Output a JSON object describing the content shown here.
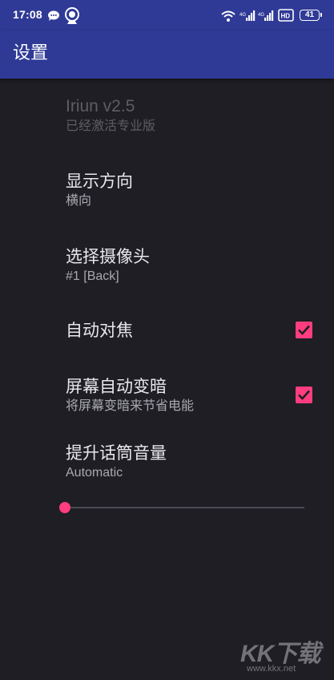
{
  "status_bar": {
    "time": "17:08",
    "battery": "41",
    "icons": [
      "chat-bubble-icon",
      "webcam-icon",
      "wifi-icon",
      "signal-icon",
      "signal-icon",
      "hd-icon",
      "battery-icon"
    ]
  },
  "app_bar": {
    "title": "设置"
  },
  "preferences": [
    {
      "title": "Iriun v2.5",
      "summary": "已经激活专业版",
      "enabled": false
    },
    {
      "title": "显示方向",
      "summary": "横向"
    },
    {
      "title": "选择摄像头",
      "summary": "#1 [Back]"
    },
    {
      "title": "自动对焦",
      "checked": true
    },
    {
      "title": "屏幕自动变暗",
      "summary": "将屏幕变暗来节省电能",
      "checked": true
    },
    {
      "title": "提升话筒音量",
      "summary": "Automatic",
      "slider_value": 0
    }
  ],
  "watermark": {
    "logo": "KK下载",
    "url": "www.kkx.net"
  },
  "colors": {
    "primary": "#2f3a96",
    "background": "#1e1e24",
    "accent": "#ff3d7f"
  }
}
